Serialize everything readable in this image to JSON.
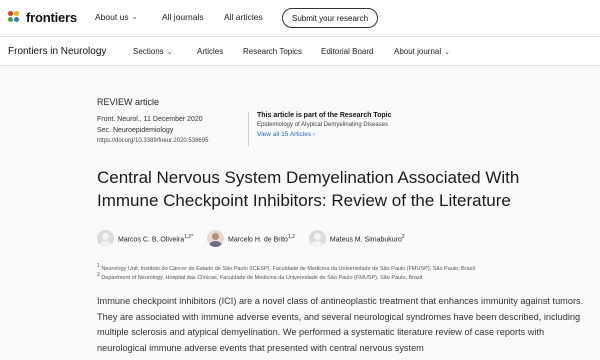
{
  "brand": {
    "name": "frontiers"
  },
  "top_nav": {
    "about": "About us",
    "journals": "All journals",
    "articles": "All articles",
    "submit": "Submit your research"
  },
  "journal_nav": {
    "title": "Frontiers in Neurology",
    "items": [
      "Sections",
      "Articles",
      "Research Topics",
      "Editorial Board",
      "About journal"
    ]
  },
  "article": {
    "type": "REVIEW article",
    "journal_date": "Front. Neurol., 11 December 2020",
    "section": "Sec. Neuroepidemiology",
    "doi": "https://doi.org/10.3389/fneur.2020.538695",
    "topic_head": "This article is part of the Research Topic",
    "topic_title": "Epidemiology of Atypical Demyelinating Diseases",
    "topic_link": "View all 15 Articles",
    "title": "Central Nervous System Demyelination Associated With Immune Checkpoint Inhibitors: Review of the Literature",
    "authors": [
      {
        "name": "Marcos C. B. Oliveira",
        "sup": "1,2*"
      },
      {
        "name": "Marcelo H. de Brito",
        "sup": "1,2"
      },
      {
        "name": "Mateus M. Simabukuro",
        "sup": "2"
      }
    ],
    "affiliations": [
      {
        "num": "1",
        "text": "Neurology Unit, Instituto do Câncer do Estado de São Paulo (ICESP), Faculdade de Medicina da Universidade de São Paulo (FMUSP), São Paulo, Brazil"
      },
      {
        "num": "2",
        "text": "Department of Neurology, Hospital das Clínicas, Faculdade de Medicina da Universidade de São Paulo (FMUSP), São Paulo, Brazil"
      }
    ],
    "abstract": "Immune checkpoint inhibitors (ICI) are a novel class of antineoplastic treatment that enhances immunity against tumors. They are associated with immune adverse events, and several neurological syndromes have been described, including multiple sclerosis and atypical demyelination. We performed a systematic literature review of case reports with neurological immune adverse events that presented with central nervous system"
  },
  "colors": {
    "link": "#1d6bb8",
    "logo_dots": [
      "#e5332a",
      "#f6a800",
      "#4aa33d",
      "#2c7ec2"
    ]
  }
}
